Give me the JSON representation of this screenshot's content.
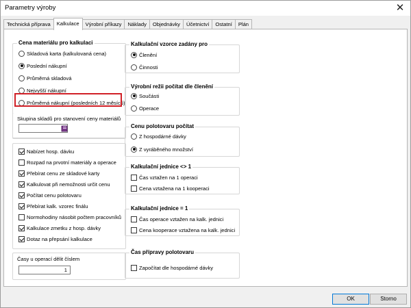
{
  "window": {
    "title": "Parametry výroby",
    "close_glyph": "✕"
  },
  "tabs": [
    "Technická příprava",
    "Kalkulace",
    "Výrobní příkazy",
    "Náklady",
    "Objednávky",
    "Účetnictví",
    "Ostatní",
    "Plán"
  ],
  "active_tab": "Kalkulace",
  "cena_materialu": {
    "title": "Cena materiálu pro kalkulaci",
    "options": [
      "Skladová karta (kalkulovaná cena)",
      "Poslední nákupní",
      "Průměrná skladová",
      "Nejvyšší nákupní",
      "Průměrná nákupní (posledních 12 měsíců)"
    ],
    "selected": "Poslední nákupní",
    "highlight_color": "#d11f26"
  },
  "skupina_skladu": {
    "label": "Skupina skladů pro stanovení ceny materiálů",
    "value": "",
    "icon": "book-icon"
  },
  "options": [
    {
      "label": "Nabízet hosp. dávku",
      "checked": true
    },
    {
      "label": "Rozpad na prvotní materiály a operace",
      "checked": false
    },
    {
      "label": "Přebírat cenu ze skladové karty",
      "checked": true
    },
    {
      "label": "Kalkulovat při nemožnosti určit cenu",
      "checked": true
    },
    {
      "label": "Počítat cenu polotovaru",
      "checked": true
    },
    {
      "label": "Přebírat kalk. vzorec finálu",
      "checked": true
    },
    {
      "label": "Normohodiny násobit počtem pracovníků",
      "checked": false
    },
    {
      "label": "Kalkulace zmetku z hosp. dávky",
      "checked": true
    },
    {
      "label": "Dotaz na přepsání kalkulace",
      "checked": true
    }
  ],
  "casy": {
    "label": "Časy u operací dělit číslem",
    "value": "1"
  },
  "vzorce": {
    "title": "Kalkulační vzorce zadány pro",
    "options": [
      "Členění",
      "Činnosti"
    ],
    "selected": "Členění"
  },
  "rezie": {
    "title": "Výrobní režii počítat dle členění",
    "options": [
      "Součásti",
      "Operace"
    ],
    "selected": "Součásti"
  },
  "cena_polotovaru": {
    "title": "Cenu polotovaru počítat",
    "options": [
      "Z hospodárné dávky",
      "Z vyráběného množství"
    ],
    "selected": "Z vyráběného množství"
  },
  "jednice_ne1": {
    "title": "Kalkulační jednice <> 1",
    "options": [
      {
        "label": "Čas vztažen na 1 operaci",
        "checked": false
      },
      {
        "label": "Cena vztažena na 1 kooperaci",
        "checked": false
      }
    ]
  },
  "jednice_1": {
    "title": "Kalkulační jednice = 1",
    "options": [
      {
        "label": "Čas operace vztažen na kalk. jednici",
        "checked": false
      },
      {
        "label": "Cena kooperace vztažena na kalk. jednici",
        "checked": false
      }
    ]
  },
  "cas_pripravy": {
    "title": "Čas přípravy polotovaru",
    "options": [
      {
        "label": "Započítat dle hospodárné dávky",
        "checked": false
      }
    ]
  },
  "buttons": {
    "ok": "OK",
    "cancel": "Storno"
  }
}
